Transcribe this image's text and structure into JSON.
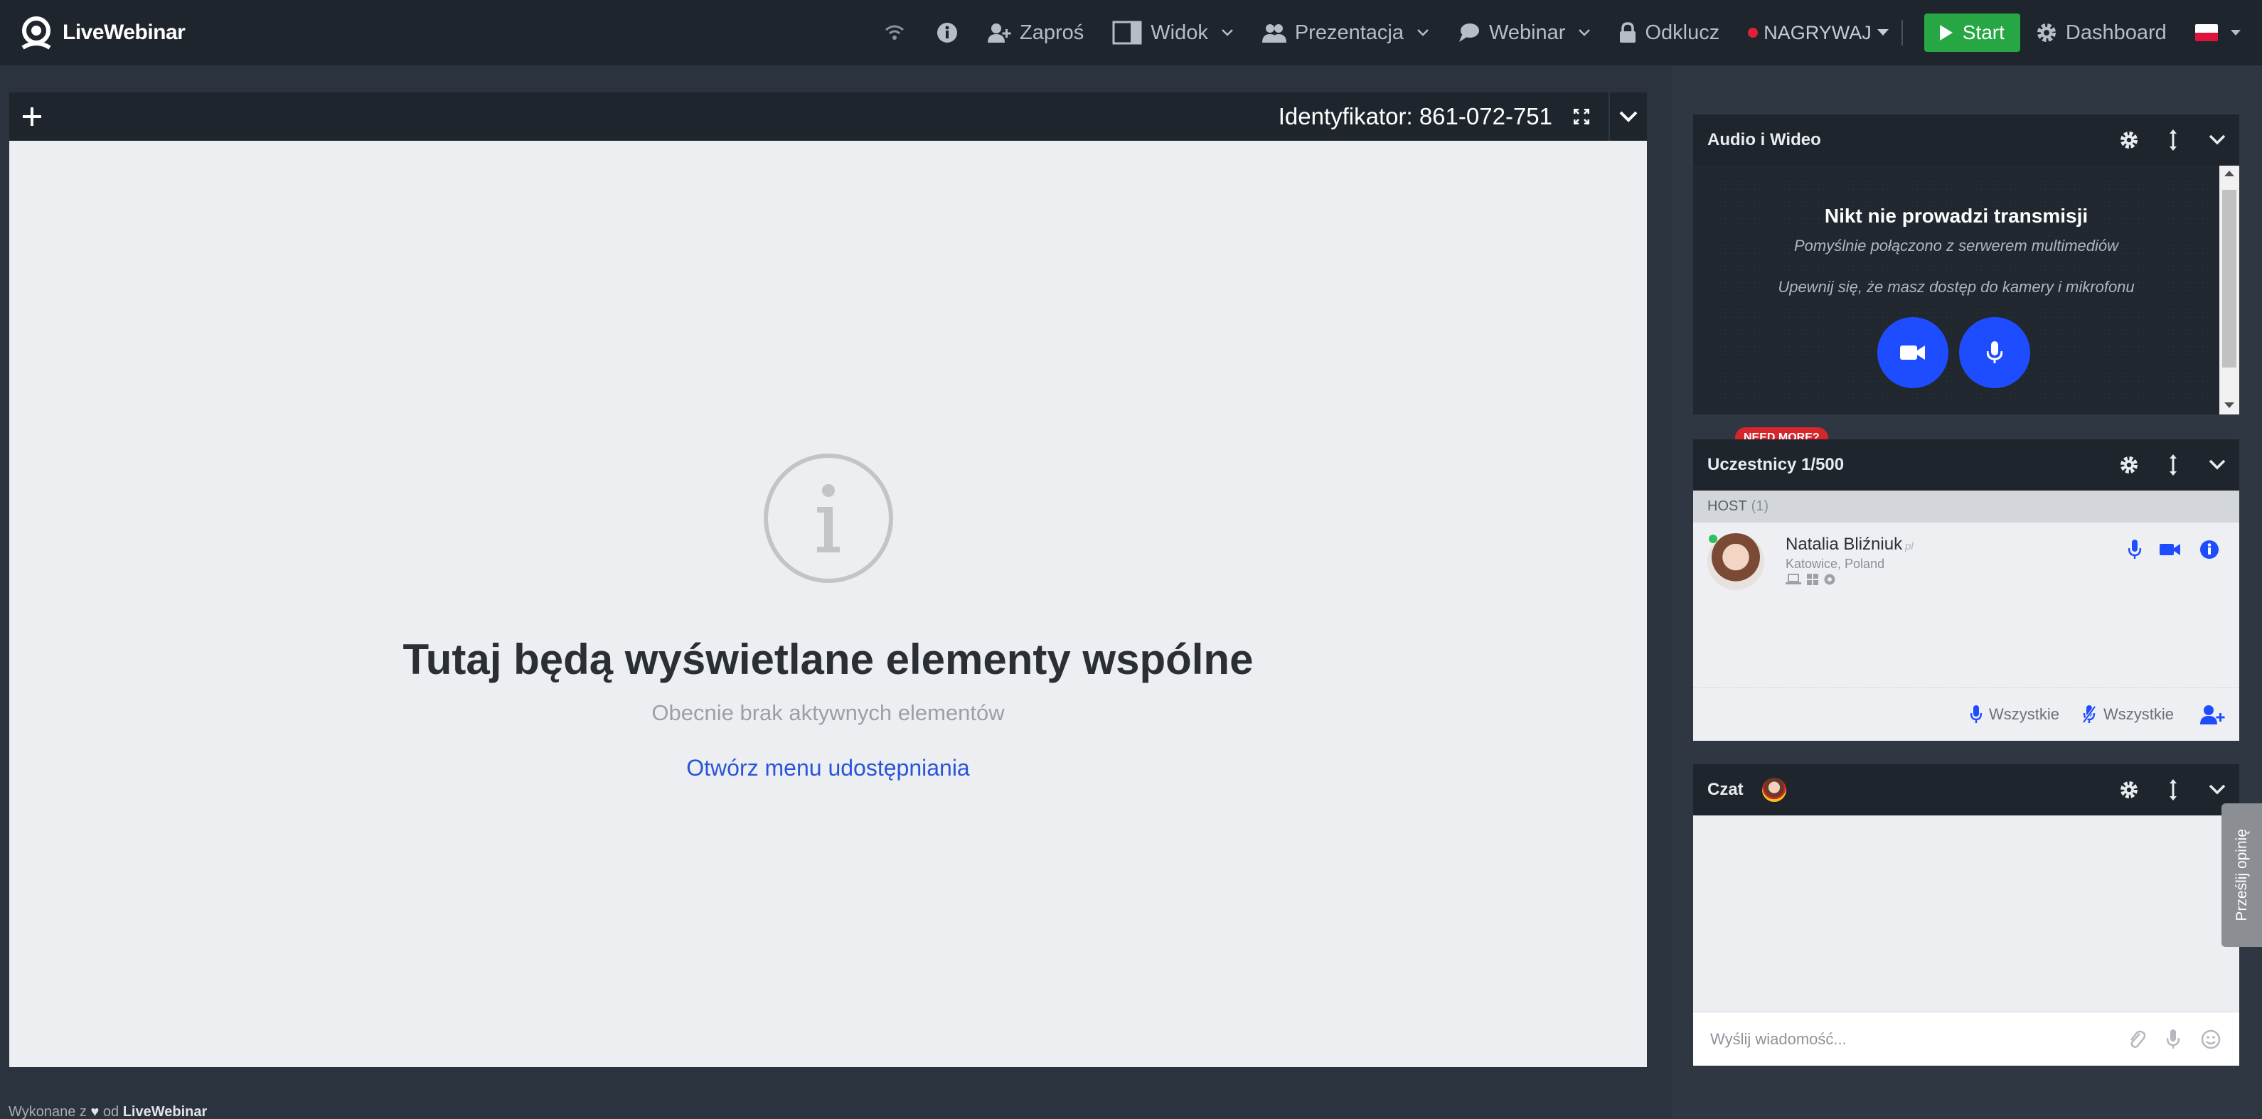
{
  "app": {
    "logo_text": "LiveWebinar"
  },
  "nav": {
    "invite": "Zaproś",
    "view": "Widok",
    "presentation": "Prezentacja",
    "webinar": "Webinar",
    "unlock": "Odklucz",
    "record": "NAGRYWAJ",
    "start": "Start",
    "dashboard": "Dashboard"
  },
  "stage": {
    "identifier": "Identyfikator: 861-072-751",
    "title": "Tutaj będą wyświetlane elementy wspólne",
    "subtitle": "Obecnie brak aktywnych elementów",
    "link": "Otwórz menu udostępniania"
  },
  "footer": {
    "made_prefix": "Wykonane z",
    "made_by": "od",
    "brand": "LiveWebinar"
  },
  "av_panel": {
    "title": "Audio i Wideo",
    "heading": "Nikt nie prowadzi transmisji",
    "line1": "Pomyślnie połączono z serwerem multimediów",
    "line2": "Upewnij się, że masz dostęp do kamery i mikrofonu"
  },
  "participants": {
    "badge": "NEED MORE?",
    "title": "Uczestnicy 1/500",
    "host_label": "HOST",
    "host_count": "(1)",
    "user": {
      "name": "Natalia Bliźniuk",
      "tag": "pl",
      "location": "Katowice, Poland"
    },
    "all_mic": "Wszystkie",
    "all_mute": "Wszystkie"
  },
  "chat": {
    "title": "Czat",
    "placeholder": "Wyślij wiadomość..."
  },
  "feedback": {
    "label": "Prześlij opinię"
  },
  "colors": {
    "accent_blue": "#1e4dff",
    "start_green": "#26a744",
    "record_red": "#e0203a",
    "badge_red": "#d7262b"
  }
}
